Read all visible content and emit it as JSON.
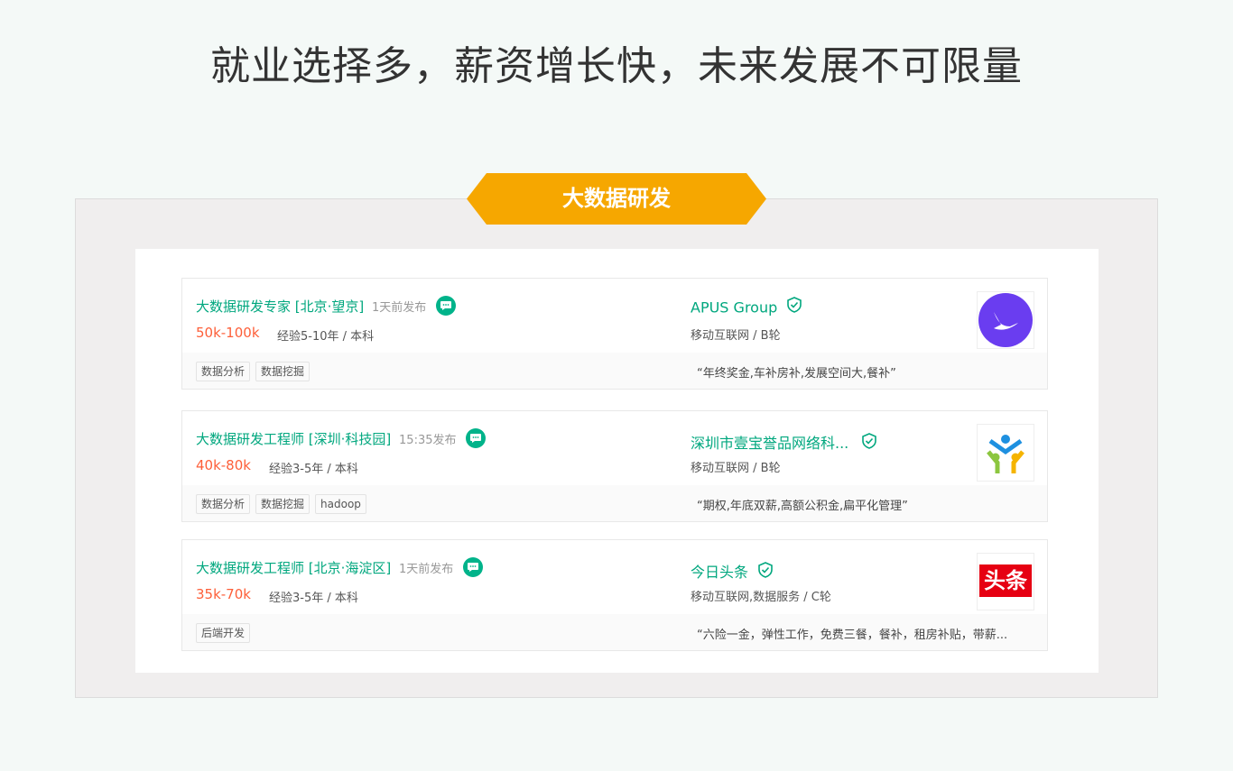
{
  "headline": "就业选择多，薪资增长快，未来发展不可限量",
  "section_title": "大数据研发",
  "colors": {
    "accent": "#00a77e",
    "salary": "#fd5f39",
    "ribbon": "#f6a700"
  },
  "jobs": [
    {
      "title": "大数据研发专家 [北京·望京]",
      "time": "1天前发布",
      "salary": "50k-100k",
      "requirement": "经验5-10年 / 本科",
      "tags": [
        "数据分析",
        "数据挖掘"
      ],
      "company": "APUS Group",
      "industry": "移动互联网 / B轮",
      "welfare": "“年终奖金,车补房补,发展空间大,餐补”",
      "logo_icon": "apus-logo-icon"
    },
    {
      "title": "大数据研发工程师 [深圳·科技园]",
      "time": "15:35发布",
      "salary": "40k-80k",
      "requirement": "经验3-5年 / 本科",
      "tags": [
        "数据分析",
        "数据挖掘",
        "hadoop"
      ],
      "company": "深圳市壹宝誉品网络科...",
      "industry": "移动互联网 / B轮",
      "welfare": "“期权,年底双薪,高额公积金,扁平化管理”",
      "logo_icon": "people-logo-icon"
    },
    {
      "title": "大数据研发工程师 [北京·海淀区]",
      "time": "1天前发布",
      "salary": "35k-70k",
      "requirement": "经验3-5年 / 本科",
      "tags": [
        "后端开发"
      ],
      "company": "今日头条",
      "industry": "移动互联网,数据服务 / C轮",
      "welfare": "“六险一金，弹性工作，免费三餐，餐补，租房补贴，带薪...",
      "logo_icon": "toutiao-logo-icon",
      "logo_text": "头条"
    }
  ]
}
